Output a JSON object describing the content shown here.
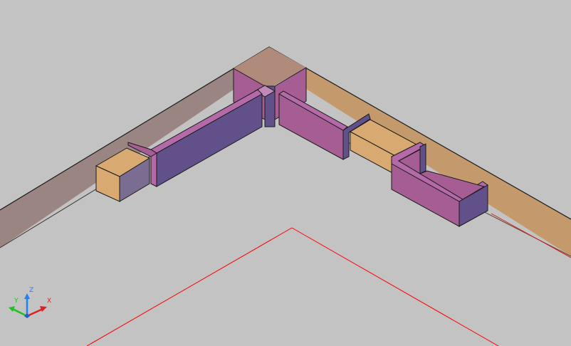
{
  "viewport": {
    "background": "#c3c3c3",
    "visual_style": "shaded-isometric",
    "colors": {
      "slab_left": "#9b8583",
      "slab_top": "#b08a7a",
      "slab_right": "#c49a6c",
      "wall_purple_dark": "#62508a",
      "wall_magenta": "#a55d94",
      "wall_pink": "#b46aa8",
      "block_tan": "#d8aa72",
      "block_side": "#7b6d92",
      "edge": "#1a1a1a",
      "red_line": "#ff0000"
    }
  },
  "ucs_icon": {
    "x_label": "X",
    "y_label": "Y",
    "z_label": "Z",
    "x_color": "#e02020",
    "y_color": "#20c020",
    "z_color": "#2080ff"
  }
}
